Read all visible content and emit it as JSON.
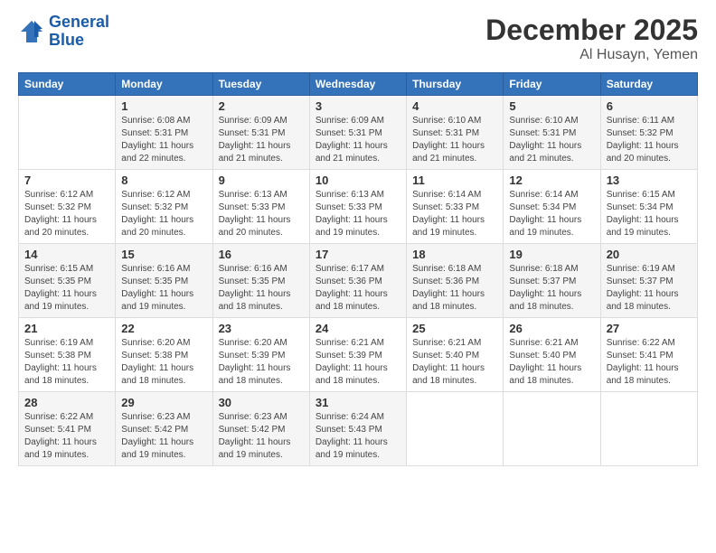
{
  "logo": {
    "line1": "General",
    "line2": "Blue"
  },
  "header": {
    "title": "December 2025",
    "location": "Al Husayn, Yemen"
  },
  "weekdays": [
    "Sunday",
    "Monday",
    "Tuesday",
    "Wednesday",
    "Thursday",
    "Friday",
    "Saturday"
  ],
  "weeks": [
    [
      {
        "day": "",
        "info": ""
      },
      {
        "day": "1",
        "info": "Sunrise: 6:08 AM\nSunset: 5:31 PM\nDaylight: 11 hours\nand 22 minutes."
      },
      {
        "day": "2",
        "info": "Sunrise: 6:09 AM\nSunset: 5:31 PM\nDaylight: 11 hours\nand 21 minutes."
      },
      {
        "day": "3",
        "info": "Sunrise: 6:09 AM\nSunset: 5:31 PM\nDaylight: 11 hours\nand 21 minutes."
      },
      {
        "day": "4",
        "info": "Sunrise: 6:10 AM\nSunset: 5:31 PM\nDaylight: 11 hours\nand 21 minutes."
      },
      {
        "day": "5",
        "info": "Sunrise: 6:10 AM\nSunset: 5:31 PM\nDaylight: 11 hours\nand 21 minutes."
      },
      {
        "day": "6",
        "info": "Sunrise: 6:11 AM\nSunset: 5:32 PM\nDaylight: 11 hours\nand 20 minutes."
      }
    ],
    [
      {
        "day": "7",
        "info": "Sunrise: 6:12 AM\nSunset: 5:32 PM\nDaylight: 11 hours\nand 20 minutes."
      },
      {
        "day": "8",
        "info": "Sunrise: 6:12 AM\nSunset: 5:32 PM\nDaylight: 11 hours\nand 20 minutes."
      },
      {
        "day": "9",
        "info": "Sunrise: 6:13 AM\nSunset: 5:33 PM\nDaylight: 11 hours\nand 20 minutes."
      },
      {
        "day": "10",
        "info": "Sunrise: 6:13 AM\nSunset: 5:33 PM\nDaylight: 11 hours\nand 19 minutes."
      },
      {
        "day": "11",
        "info": "Sunrise: 6:14 AM\nSunset: 5:33 PM\nDaylight: 11 hours\nand 19 minutes."
      },
      {
        "day": "12",
        "info": "Sunrise: 6:14 AM\nSunset: 5:34 PM\nDaylight: 11 hours\nand 19 minutes."
      },
      {
        "day": "13",
        "info": "Sunrise: 6:15 AM\nSunset: 5:34 PM\nDaylight: 11 hours\nand 19 minutes."
      }
    ],
    [
      {
        "day": "14",
        "info": "Sunrise: 6:15 AM\nSunset: 5:35 PM\nDaylight: 11 hours\nand 19 minutes."
      },
      {
        "day": "15",
        "info": "Sunrise: 6:16 AM\nSunset: 5:35 PM\nDaylight: 11 hours\nand 19 minutes."
      },
      {
        "day": "16",
        "info": "Sunrise: 6:16 AM\nSunset: 5:35 PM\nDaylight: 11 hours\nand 18 minutes."
      },
      {
        "day": "17",
        "info": "Sunrise: 6:17 AM\nSunset: 5:36 PM\nDaylight: 11 hours\nand 18 minutes."
      },
      {
        "day": "18",
        "info": "Sunrise: 6:18 AM\nSunset: 5:36 PM\nDaylight: 11 hours\nand 18 minutes."
      },
      {
        "day": "19",
        "info": "Sunrise: 6:18 AM\nSunset: 5:37 PM\nDaylight: 11 hours\nand 18 minutes."
      },
      {
        "day": "20",
        "info": "Sunrise: 6:19 AM\nSunset: 5:37 PM\nDaylight: 11 hours\nand 18 minutes."
      }
    ],
    [
      {
        "day": "21",
        "info": "Sunrise: 6:19 AM\nSunset: 5:38 PM\nDaylight: 11 hours\nand 18 minutes."
      },
      {
        "day": "22",
        "info": "Sunrise: 6:20 AM\nSunset: 5:38 PM\nDaylight: 11 hours\nand 18 minutes."
      },
      {
        "day": "23",
        "info": "Sunrise: 6:20 AM\nSunset: 5:39 PM\nDaylight: 11 hours\nand 18 minutes."
      },
      {
        "day": "24",
        "info": "Sunrise: 6:21 AM\nSunset: 5:39 PM\nDaylight: 11 hours\nand 18 minutes."
      },
      {
        "day": "25",
        "info": "Sunrise: 6:21 AM\nSunset: 5:40 PM\nDaylight: 11 hours\nand 18 minutes."
      },
      {
        "day": "26",
        "info": "Sunrise: 6:21 AM\nSunset: 5:40 PM\nDaylight: 11 hours\nand 18 minutes."
      },
      {
        "day": "27",
        "info": "Sunrise: 6:22 AM\nSunset: 5:41 PM\nDaylight: 11 hours\nand 18 minutes."
      }
    ],
    [
      {
        "day": "28",
        "info": "Sunrise: 6:22 AM\nSunset: 5:41 PM\nDaylight: 11 hours\nand 19 minutes."
      },
      {
        "day": "29",
        "info": "Sunrise: 6:23 AM\nSunset: 5:42 PM\nDaylight: 11 hours\nand 19 minutes."
      },
      {
        "day": "30",
        "info": "Sunrise: 6:23 AM\nSunset: 5:42 PM\nDaylight: 11 hours\nand 19 minutes."
      },
      {
        "day": "31",
        "info": "Sunrise: 6:24 AM\nSunset: 5:43 PM\nDaylight: 11 hours\nand 19 minutes."
      },
      {
        "day": "",
        "info": ""
      },
      {
        "day": "",
        "info": ""
      },
      {
        "day": "",
        "info": ""
      }
    ]
  ]
}
